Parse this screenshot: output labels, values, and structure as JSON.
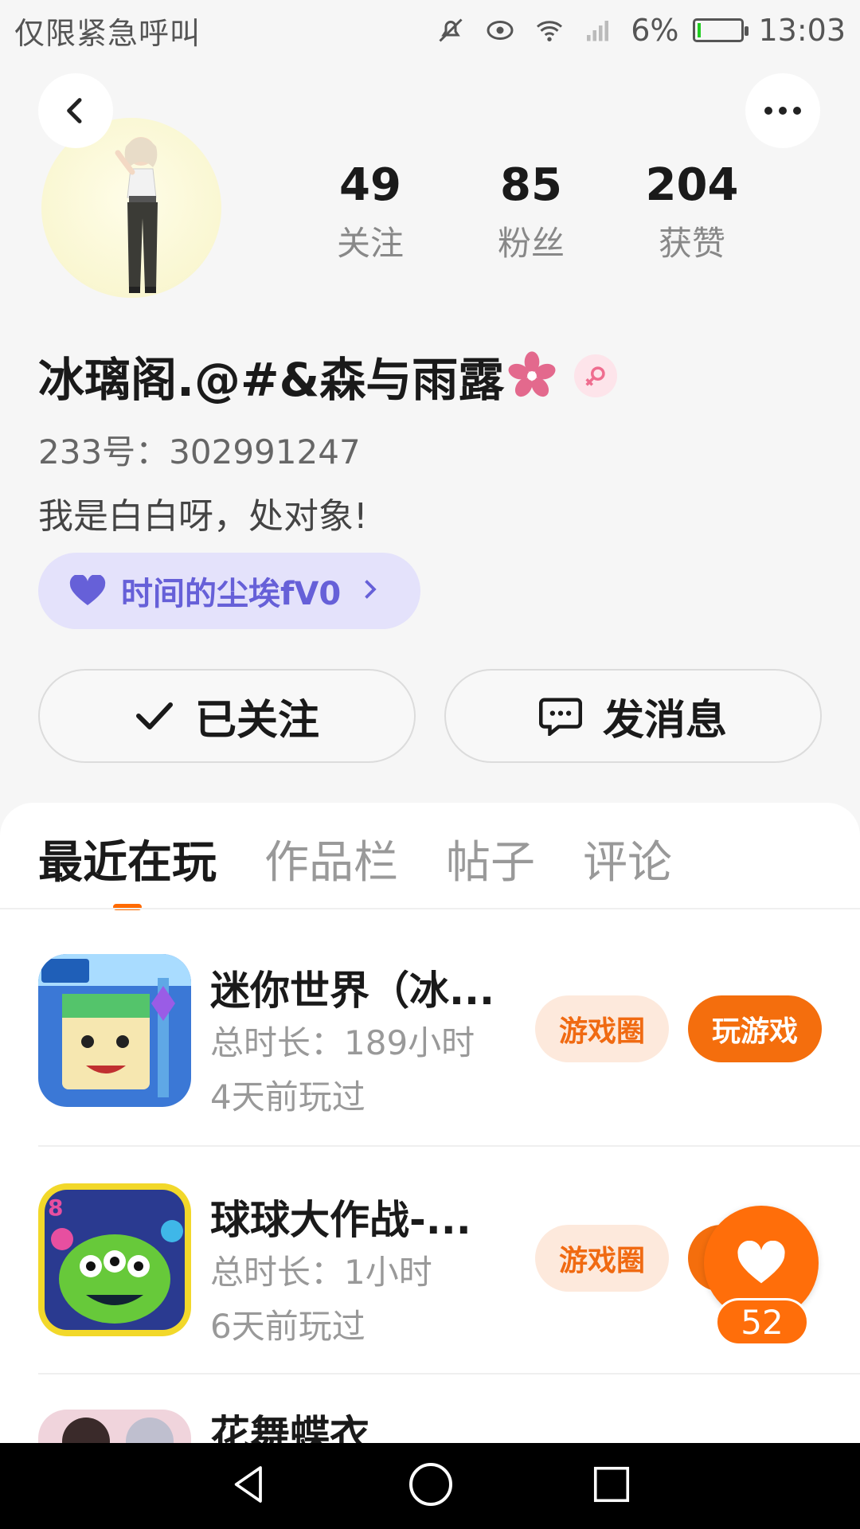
{
  "status_bar": {
    "carrier_text": "仅限紧急呼叫",
    "battery_percent": "6%",
    "battery_level": 0.06,
    "time": "13:03"
  },
  "profile": {
    "stats": [
      {
        "value": "49",
        "label": "关注"
      },
      {
        "value": "85",
        "label": "粉丝"
      },
      {
        "value": "204",
        "label": "获赞"
      }
    ],
    "name": "冰璃阁.@#&森与雨露",
    "id_text": "233号：302991247",
    "bio": "我是白白呀，处对象!",
    "guild_label": "时间的尘埃fV0"
  },
  "actions": {
    "follow_label": "已关注",
    "message_label": "发消息"
  },
  "tabs": [
    "最近在玩",
    "作品栏",
    "帖子",
    "评论"
  ],
  "games": [
    {
      "title": "迷你世界（冰...",
      "duration": "总时长：189小时",
      "last_played": "4天前玩过",
      "circle_label": "游戏圈",
      "play_label": "玩游戏"
    },
    {
      "title": "球球大作战-...",
      "duration": "总时长：1小时",
      "last_played": "6天前玩过",
      "circle_label": "游戏圈",
      "play_label": ""
    },
    {
      "title": "花舞蝶衣",
      "duration": "",
      "last_played": "",
      "circle_label": "",
      "play_label": ""
    }
  ],
  "like_fab": {
    "count": "52"
  },
  "colors": {
    "accent": "#ff6e0a",
    "guild": "#6660d8"
  }
}
